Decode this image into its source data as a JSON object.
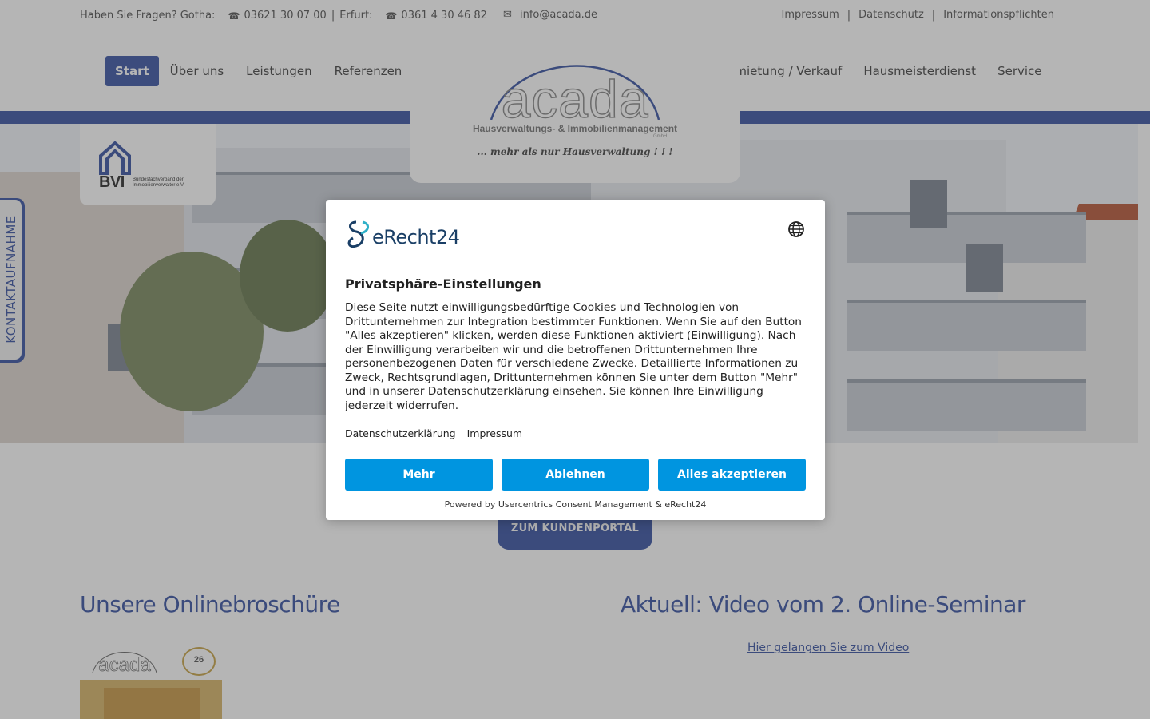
{
  "topbar": {
    "question": "Haben Sie Fragen? Gotha:",
    "phone_gotha": "03621 30 07 00",
    "pipe": "|",
    "erfurt_label": "Erfurt:",
    "phone_erfurt": "0361 4 30 46 82",
    "email": "info@acada.de",
    "links": [
      "Impressum",
      "Datenschutz",
      "Informationspflichten"
    ]
  },
  "nav": {
    "left": [
      "Start",
      "Über uns",
      "Leistungen",
      "Referenzen"
    ],
    "right": [
      "Vermietung / Verkauf",
      "Hausmeisterdienst",
      "Service"
    ]
  },
  "logo": {
    "name": "acada",
    "subtitle": "Hausverwaltungs- & Immobilienmanagement",
    "gmbh": "GmbH",
    "slogan": "... mehr als nur Hausverwaltung ! ! !"
  },
  "bvi": {
    "abbr": "BVI",
    "text": "Bundesfachverband der Immobilienverwalter e.V."
  },
  "side_tab": {
    "label": "KONTAKTAUFNAHME"
  },
  "portal_button": "ZUM KUNDENPORTAL",
  "sections": {
    "left_heading": "Unsere Onlinebroschüre",
    "right_heading": "Aktuell: Video vom 2. Online-Seminar",
    "video_link": "Hier gelangen Sie zum Video",
    "brochure_seal": "26"
  },
  "consent": {
    "brand": "eRecht24",
    "title": "Privatsphäre-Einstellungen",
    "body": "Diese Seite nutzt einwilligungsbedürftige Cookies und Technologien von Drittunternehmen zur Integration bestimmter Funktionen. Wenn Sie auf den Button \"Alles akzeptieren\" klicken, werden diese Funktionen aktiviert (Einwilligung). Nach der Einwilligung verarbeiten wir und die betroffenen Drittunternehmen Ihre personenbezogenen Daten für verschiedene Zwecke. Detaillierte Informationen zu Zweck, Rechtsgrundlagen, Drittunternehmen können Sie unter dem Button \"Mehr\" und in unserer Datenschutzerklärung einsehen. Sie können Ihre Einwilligung jederzeit widerrufen.",
    "link_privacy": "Datenschutzerklärung",
    "link_imprint": "Impressum",
    "btn_more": "Mehr",
    "btn_decline": "Ablehnen",
    "btn_accept": "Alles akzeptieren",
    "powered": "Powered by Usercentrics Consent Management & eRecht24",
    "colors": {
      "button": "#0095e0",
      "brand_blue": "#3b55a3"
    }
  }
}
